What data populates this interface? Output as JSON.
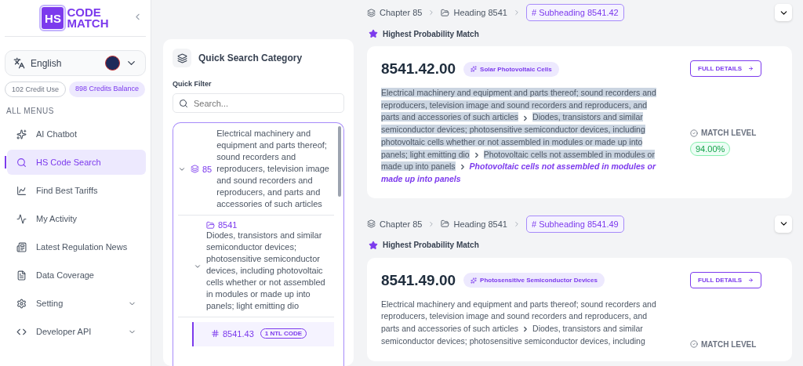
{
  "sidebar": {
    "logo": {
      "badge": "HS",
      "line1": "CODE",
      "line2": "MATCH"
    },
    "language": "English",
    "credits": [
      {
        "label": "102 Credit Use",
        "kind": "outline"
      },
      {
        "label": "898 Credits Balance",
        "kind": "filled"
      }
    ],
    "section_title": "ALL MENUS",
    "items": [
      {
        "label": "AI Chatbot",
        "selected": false,
        "expandable": false
      },
      {
        "label": "HS Code Search",
        "selected": true,
        "expandable": false
      },
      {
        "label": "Find Best Tariffs",
        "selected": false,
        "expandable": false
      },
      {
        "label": "My Activity",
        "selected": false,
        "expandable": false
      },
      {
        "label": "Latest Regulation News",
        "selected": false,
        "expandable": false
      },
      {
        "label": "Data Coverage",
        "selected": false,
        "expandable": false
      },
      {
        "label": "Setting",
        "selected": false,
        "expandable": true
      },
      {
        "label": "Developer API",
        "selected": false,
        "expandable": true
      }
    ]
  },
  "quick_search": {
    "title": "Quick Search Category",
    "filter_label": "Quick Filter",
    "search": {
      "placeholder": "Search..."
    },
    "tree": [
      {
        "kind": "chapter",
        "code": "85",
        "expanded": true,
        "text": "Electrical machinery and equipment and parts thereof; sound recorders and reproducers, television image and sound recorders and reproducers, and parts and accessories of such articles",
        "children": [
          {
            "kind": "heading",
            "code": "8541",
            "expanded": true,
            "text": "Diodes, transistors and similar semiconductor devices; photosensitive semiconductor devices, including photovoltaic cells whether or not assembled in modules or made up into panels; light emitting dio",
            "children": [
              {
                "kind": "subheading",
                "code": "8541.43",
                "badge": "1 NTL CODE",
                "selected": true
              }
            ]
          }
        ]
      }
    ]
  },
  "results": [
    {
      "breadcrumb": [
        {
          "kind": "chapter",
          "text": "Chapter 85"
        },
        {
          "kind": "heading",
          "text": "Heading 8541"
        },
        {
          "kind": "subheading",
          "text": "# Subheading 8541.42"
        }
      ],
      "match_label": "Highest Probability Match",
      "code": "8541.42.00",
      "tag": "Solar Photovoltaic Cells",
      "button": "FULL DETAILS",
      "segments": [
        {
          "kind": "path",
          "highlighted": true,
          "text": "Electrical machinery and equipment and parts thereof; sound recorders and reproducers, television image and sound recorders and reproducers, and parts and accessories of such articles"
        },
        {
          "kind": "path",
          "highlighted": true,
          "text": "Diodes, transistors and similar semiconductor devices; photosensitive semiconductor devices, including photovoltaic cells whether or not assembled in modules or made up into panels; light emitting dio"
        },
        {
          "kind": "path",
          "highlighted": true,
          "text": "Photovoltaic cells not assembled in modules or made up into panels"
        },
        {
          "kind": "current",
          "highlighted": false,
          "text": "Photovoltaic cells not assembled in modules or made up into panels"
        }
      ],
      "level_label": "MATCH LEVEL",
      "level_value": "94.00%"
    },
    {
      "breadcrumb": [
        {
          "kind": "chapter",
          "text": "Chapter 85"
        },
        {
          "kind": "heading",
          "text": "Heading 8541"
        },
        {
          "kind": "subheading",
          "text": "# Subheading 8541.49"
        }
      ],
      "match_label": "Highest Probability Match",
      "code": "8541.49.00",
      "tag": "Photosensitive Semiconductor Devices",
      "button": "FULL DETAILS",
      "segments": [
        {
          "kind": "path",
          "highlighted": false,
          "text": "Electrical machinery and equipment and parts thereof; sound recorders and reproducers, television image and sound recorders and reproducers, and parts and accessories of such articles"
        },
        {
          "kind": "path",
          "highlighted": false,
          "text": "Diodes, transistors and similar semiconductor devices; photosensitive semiconductor devices, including"
        }
      ],
      "level_label": "MATCH LEVEL"
    }
  ]
}
